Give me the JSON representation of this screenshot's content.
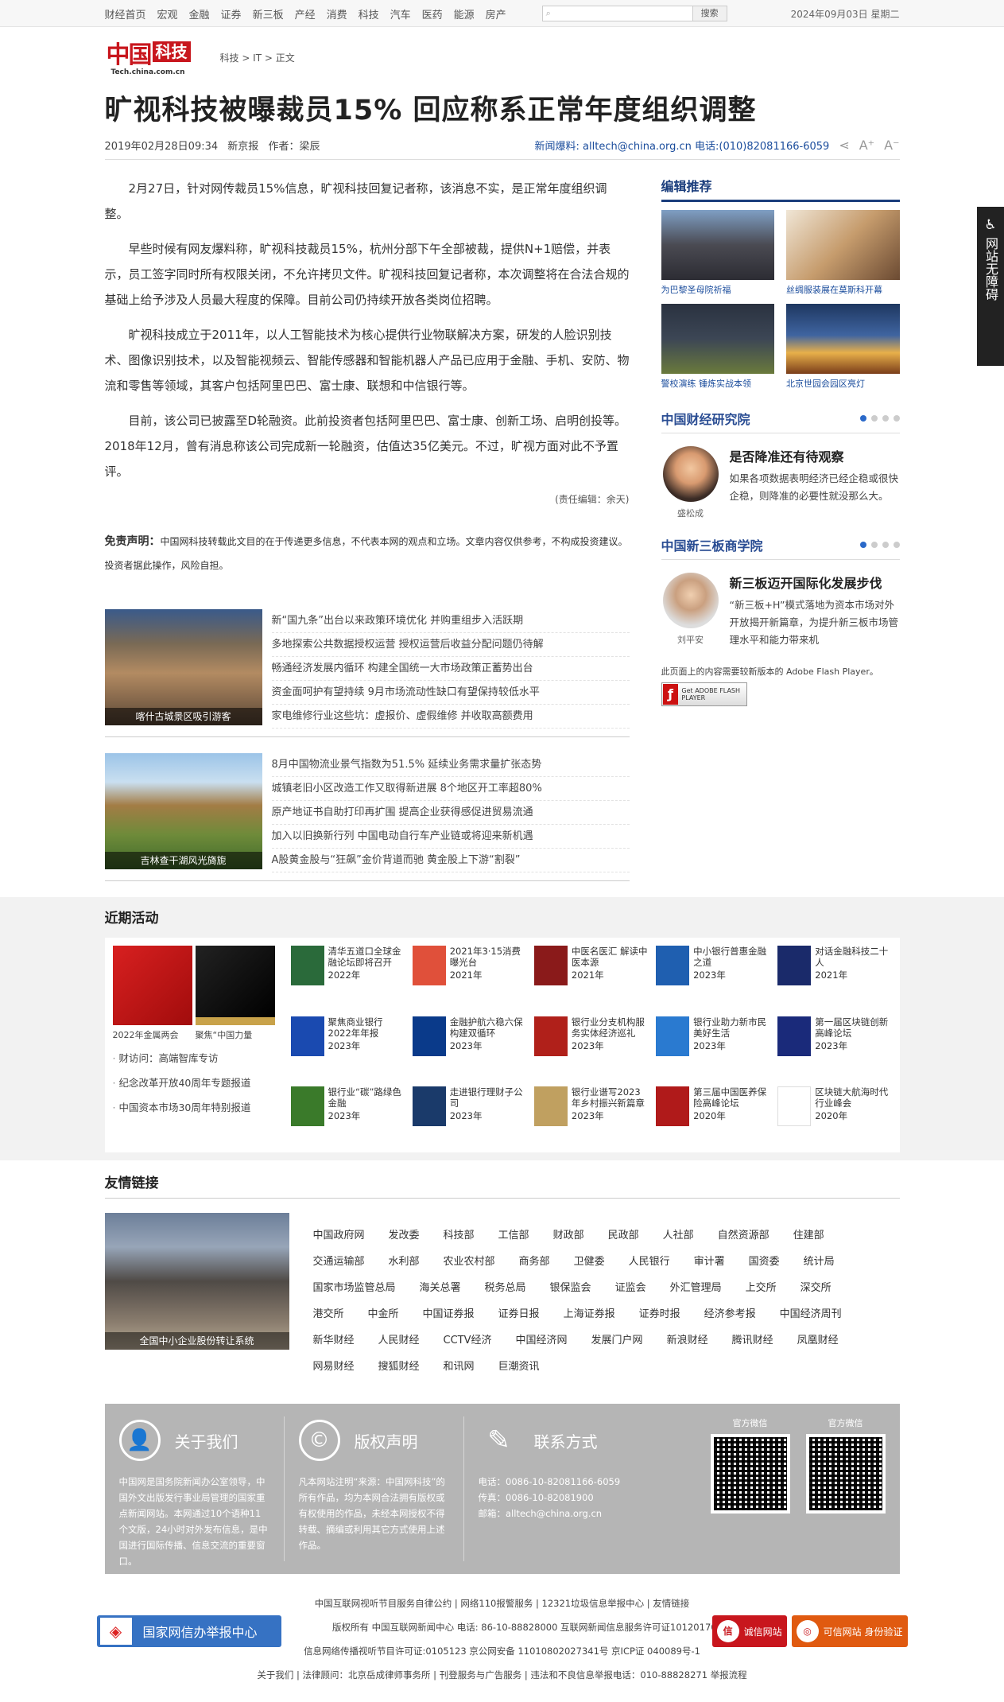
{
  "topnav": [
    "财经首页",
    "宏观",
    "金融",
    "证券",
    "新三板",
    "产经",
    "消费",
    "科技",
    "汽车",
    "医药",
    "能源",
    "房产"
  ],
  "search": {
    "button": "搜索"
  },
  "date": "2024年09月03日 星期二",
  "logo": {
    "mark": "中国",
    "channel": "科技",
    "url": "Tech.china.com.cn"
  },
  "breadcrumb": "科技 > IT > 正文",
  "article": {
    "title": "旷视科技被曝裁员15% 回应称系正常年度组织调整",
    "datetime": "2019年02月28日09:34",
    "source": "新京报",
    "author": "作者：梁辰",
    "hotline": "新闻爆料: alltech@china.org.cn 电话:(010)82081166-6059",
    "paragraphs": [
      "2月27日，针对网传裁员15%信息，旷视科技回复记者称，该消息不实，是正常年度组织调整。",
      "早些时候有网友爆料称，旷视科技裁员15%，杭州分部下午全部被裁，提供N+1赔偿，并表示，员工签字同时所有权限关闭，不允许拷贝文件。旷视科技回复记者称，本次调整将在合法合规的基础上给予涉及人员最大程度的保障。目前公司仍持续开放各类岗位招聘。",
      "旷视科技成立于2011年，以人工智能技术为核心提供行业物联解决方案，研发的人脸识别技术、图像识别技术，以及智能视频云、智能传感器和智能机器人产品已应用于金融、手机、安防、物流和零售等领域，其客户包括阿里巴巴、富士康、联想和中信银行等。",
      "目前，该公司已披露至D轮融资。此前投资者包括阿里巴巴、富士康、创新工场、启明创投等。2018年12月，曾有消息称该公司完成新一轮融资，估值达35亿美元。不过，旷视方面对此不予置评。"
    ],
    "editor": "(责任编辑：余天)",
    "disclaimer_label": "免责声明：",
    "disclaimer": "中国网科技转载此文目的在于传递更多信息，不代表本网的观点和立场。文章内容仅供参考，不构成投资建议。投资者据此操作，风险自担。"
  },
  "news_blocks": [
    {
      "caption": "喀什古城景区吸引游客",
      "items": [
        "新“国九条”出台以来政策环境优化 并购重组步入活跃期",
        "多地探索公共数据授权运营 授权运营后收益分配问题仍待解",
        "畅通经济发展内循环 构建全国统一大市场政策正蓄势出台",
        "资金面呵护有望持续 9月市场流动性缺口有望保持较低水平",
        "家电维修行业这些坑：虚报价、虚假维修 并收取高额费用"
      ]
    },
    {
      "caption": "吉林查干湖风光旖旎",
      "items": [
        "8月中国物流业景气指数为51.5% 延续业务需求量扩张态势",
        "城镇老旧小区改造工作又取得新进展 8个地区开工率超80%",
        "原产地证书自助打印再扩围 提高企业获得感促进贸易流通",
        "加入以旧换新行列 中国电动自行车产业链或将迎来新机遇",
        "A股黄金股与“狂飙”金价背道而驰 黄金股上下游“割裂”"
      ]
    }
  ],
  "editor_pick": {
    "title": "编辑推荐",
    "items": [
      "为巴黎圣母院祈福",
      "丝绸服装展在莫斯科开幕",
      "警校演练 锤炼实战本领",
      "北京世园会园区亮灯"
    ]
  },
  "research": {
    "title": "中国财经研究院",
    "name": "盛松成",
    "headline": "是否降准还有待观察",
    "text": "如果各项数据表明经济已经企稳或很快企稳，则降准的必要性就没那么大。"
  },
  "neeq": {
    "title": "中国新三板商学院",
    "name": "刘平安",
    "headline": "新三板迈开国际化发展步伐",
    "text": "“新三板+H”模式落地为资本市场对外开放揭开新篇章，为提升新三板市场管理水平和能力带来机"
  },
  "flash": {
    "notice": "此页面上的内容需要较新版本的 Adobe Flash Player。",
    "button": "Get ADOBE FLASH PLAYER"
  },
  "activities": {
    "title": "近期活动",
    "feature_caps": [
      "2022年金属两会",
      "聚焦“中国力量"
    ],
    "list": [
      "财访问：高端智库专访",
      "纪念改革开放40周年专题报道",
      "中国资本市场30周年特别报道"
    ],
    "items": [
      {
        "t": "清华五道口全球金融论坛即将召开",
        "y": "2022年"
      },
      {
        "t": "2021年3·15消费曝光台",
        "y": "2021年"
      },
      {
        "t": "中医名医汇 解读中医本源",
        "y": "2021年"
      },
      {
        "t": "中小银行普惠金融之道",
        "y": "2023年"
      },
      {
        "t": "对话金融科技二十人",
        "y": "2021年"
      },
      {
        "t": "聚焦商业银行2022年年报",
        "y": "2023年"
      },
      {
        "t": "金融护航六稳六保 构建双循环",
        "y": "2023年"
      },
      {
        "t": "银行业分支机构服务实体经济巡礼",
        "y": "2023年"
      },
      {
        "t": "银行业助力新市民美好生活",
        "y": "2023年"
      },
      {
        "t": "第一届区块链创新高峰论坛",
        "y": "2023年"
      },
      {
        "t": "银行业“碳”路绿色金融",
        "y": "2023年"
      },
      {
        "t": "走进银行理财子公司",
        "y": "2023年"
      },
      {
        "t": "银行业谱写2023年乡村振兴新篇章",
        "y": "2023年"
      },
      {
        "t": "第三届中国医养保险高峰论坛",
        "y": "2020年"
      },
      {
        "t": "区块链大航海时代行业峰会",
        "y": "2020年"
      }
    ]
  },
  "links": {
    "title": "友情链接",
    "caption": "全国中小企业股份转让系统",
    "items": [
      "中国政府网",
      "发改委",
      "科技部",
      "工信部",
      "财政部",
      "民政部",
      "人社部",
      "自然资源部",
      "住建部",
      "交通运输部",
      "水利部",
      "农业农村部",
      "商务部",
      "卫健委",
      "人民银行",
      "审计署",
      "国资委",
      "统计局",
      "国家市场监管总局",
      "海关总署",
      "税务总局",
      "银保监会",
      "证监会",
      "外汇管理局",
      "上交所",
      "深交所",
      "港交所",
      "中金所",
      "中国证券报",
      "证券日报",
      "上海证券报",
      "证券时报",
      "经济参考报",
      "中国经济周刊",
      "新华财经",
      "人民财经",
      "CCTV经济",
      "中国经济网",
      "发展门户网",
      "新浪财经",
      "腾讯财经",
      "凤凰财经",
      "网易财经",
      "搜狐财经",
      "和讯网",
      "巨潮资讯"
    ]
  },
  "footer": {
    "about": {
      "title": "关于我们",
      "text": "中国网是国务院新闻办公室领导，中国外文出版发行事业局管理的国家重点新闻网站。本网通过10个语种11个文版，24小时对外发布信息，是中国进行国际传播、信息交流的重要窗口。"
    },
    "copyright": {
      "title": "版权声明",
      "text": "凡本网站注明“来源：中国网科技”的所有作品，均为本网合法拥有版权或有权使用的作品，未经本网授权不得转载、摘编或利用其它方式使用上述作品。"
    },
    "contact": {
      "title": "联系方式",
      "phone": "电话：0086-10-82081166-6059",
      "fax": "传真：0086-10-82081900",
      "mail": "邮箱：alltech@china.org.cn"
    },
    "qr": [
      "官方微信",
      "官方微信"
    ]
  },
  "bottom": {
    "lines": [
      "中国互联网视听节目服务自律公约 | 网络110报警服务 | 12321垃圾信息举报中心 | 友情链接",
      "版权所有 中国互联网新闻中心 电话: 86-10-88828000 互联网新闻信息服务许可证10120170004号",
      "信息网络传播视听节目许可证:0105123  京公网安备 11010802027341号 京ICP证 040089号-1",
      "关于我们 | 法律顾问：北京岳成律师事务所 | 刊登服务与广告服务 | 违法和不良信息举报电话：010-88828271 举报流程"
    ],
    "report": "国家网信办举报中心",
    "badge1": "诚信网站",
    "badge2": "可信网站 身份验证"
  },
  "accessibility": "网站无障碍"
}
